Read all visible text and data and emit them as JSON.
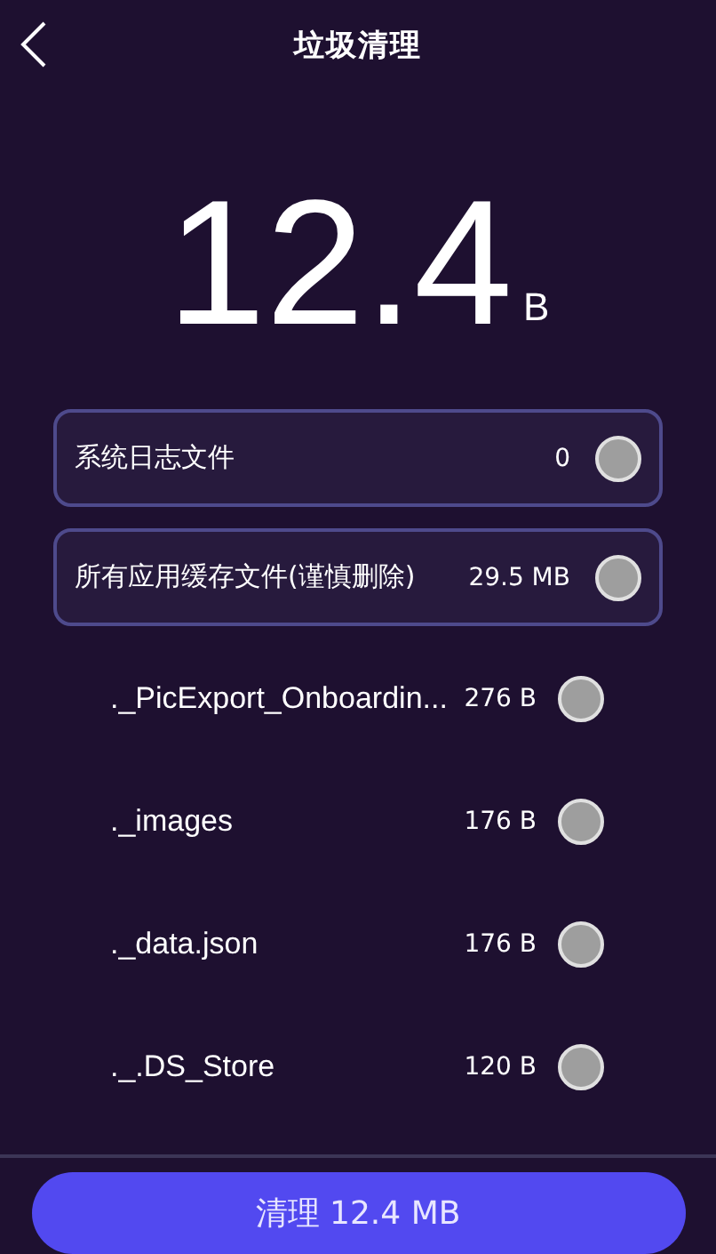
{
  "header": {
    "title": "垃圾清理"
  },
  "total": {
    "value": "12.4",
    "unit": "B"
  },
  "items": [
    {
      "kind": "group",
      "name": "系统日志文件",
      "size": "0",
      "checked": false
    },
    {
      "kind": "group",
      "name": "所有应用缓存文件(谨慎删除)",
      "size": "29.5 MB",
      "checked": false
    },
    {
      "kind": "file",
      "name": "._PicExport_Onboardin...",
      "size": "276 B",
      "checked": false
    },
    {
      "kind": "file",
      "name": "._images",
      "size": "176 B",
      "checked": false
    },
    {
      "kind": "file",
      "name": "._data.json",
      "size": "176 B",
      "checked": false
    },
    {
      "kind": "file",
      "name": "._.DS_Store",
      "size": "120 B",
      "checked": false
    }
  ],
  "clean_button": {
    "label": "清理 12.4 MB"
  }
}
